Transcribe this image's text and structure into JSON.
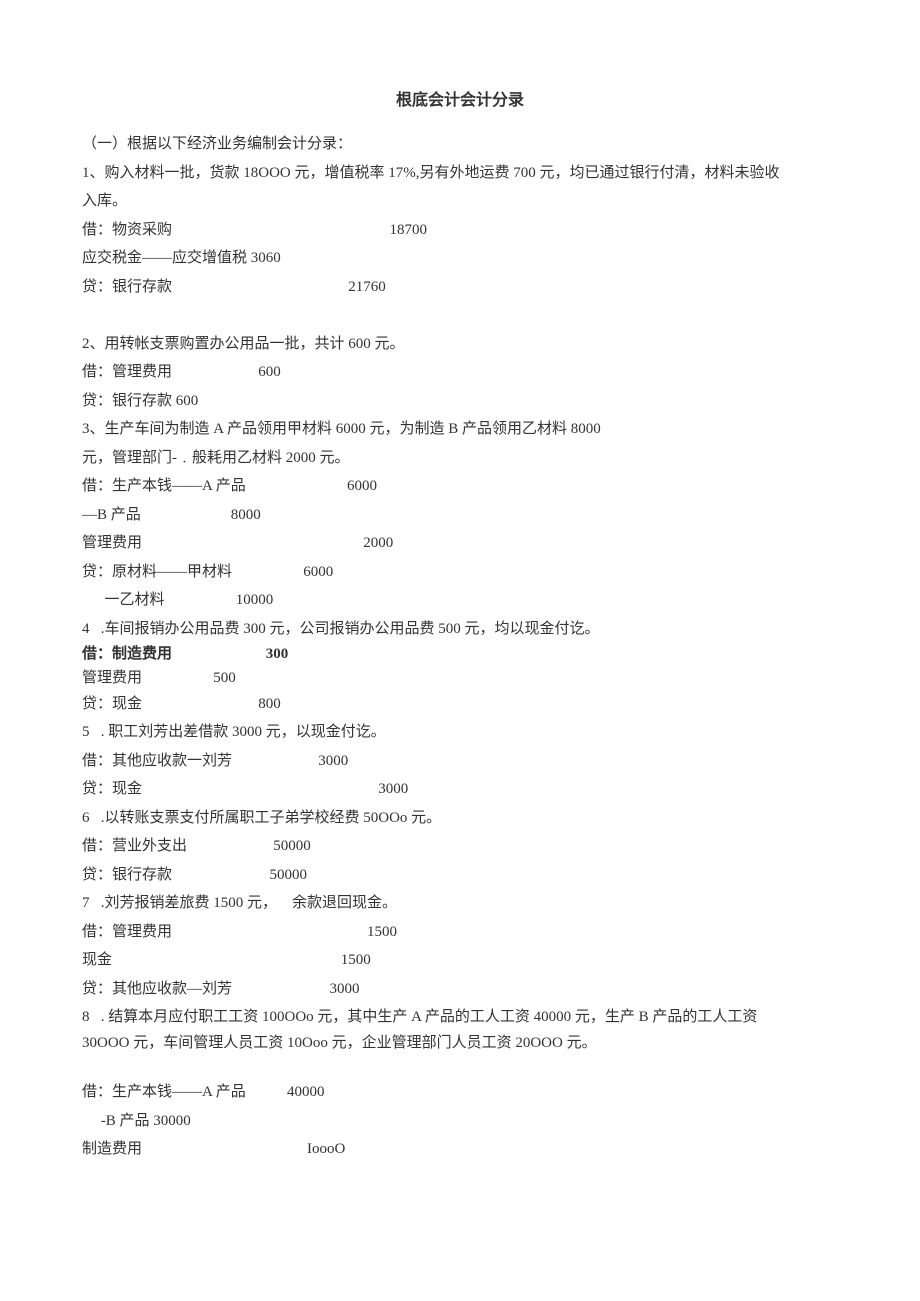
{
  "title": "根底会计会计分录",
  "lines": [
    {
      "text": "（一）根据以下经济业务编制会计分录："
    },
    {
      "text": "1、购入材料一批，货款 18OOO 元，增值税率 17%,另有外地运费 700 元，均已通过银行付清，材料未验收"
    },
    {
      "text": "入库。"
    },
    {
      "text": "借：物资采购                                                          18700"
    },
    {
      "text": "应交税金——应交增值税 3060"
    },
    {
      "text": "贷：银行存款                                               21760"
    },
    {
      "text": " "
    },
    {
      "text": "2、用转帐支票购置办公用品一批，共计 600 元。"
    },
    {
      "text": "借：管理费用                       600"
    },
    {
      "text": "贷：银行存款 600"
    },
    {
      "text": "3、生产车间为制造 A 产品领用甲材料 6000 元，为制造 B 产品领用乙材料 8000"
    },
    {
      "text": "元，管理部门-﹒般耗用乙材料 2000 元。"
    },
    {
      "text": "借：生产本钱——A 产品                           6000"
    },
    {
      "text": "—B 产品                        8000"
    },
    {
      "text": "管理费用                                                           2000"
    },
    {
      "text": "贷：原材料——甲材料                   6000"
    },
    {
      "text": "      一乙材料                   10000"
    },
    {
      "text": "4   .车间报销办公用品费 300 元，公司报销办公用品费 500 元，均以现金付讫。"
    },
    {
      "text": "借：制造费用                         300",
      "cls": "bold tight"
    },
    {
      "text": "管理费用                   500",
      "cls": "tight"
    },
    {
      "text": "贷：现金                               800"
    },
    {
      "text": "5   . 职工刘芳出差借款 3000 元，以现金付讫。"
    },
    {
      "text": "借：其他应收款一刘芳                       3000"
    },
    {
      "text": "贷：现金                                                               3000"
    },
    {
      "text": "6   .以转账支票支付所属职工子弟学校经费 50OOo 元。"
    },
    {
      "text": "借：营业外支出                       50000"
    },
    {
      "text": "贷：银行存款                          50000"
    },
    {
      "text": "7   .刘芳报销差旅费 1500 元，    余款退回现金。"
    },
    {
      "text": "借：管理费用                                                    1500"
    },
    {
      "text": "现金                                                             1500"
    },
    {
      "text": "贷：其他应收款—刘芳                          3000"
    },
    {
      "text": "8   . 结算本月应付职工工资 100OOo 元，其中生产 A 产品的工人工资 40000 元，生产 B 产品的工人工资"
    },
    {
      "text": "30OOO 元，车间管理人员工资 10Ooo 元，企业管理部门人员工资 20OOO 元。",
      "cls": "tight"
    },
    {
      "text": " ",
      "cls": "tight"
    },
    {
      "text": "借：生产本钱——A 产品           40000"
    },
    {
      "text": "     -B 产品 30000"
    },
    {
      "text": "制造费用                                            IoooO"
    }
  ]
}
